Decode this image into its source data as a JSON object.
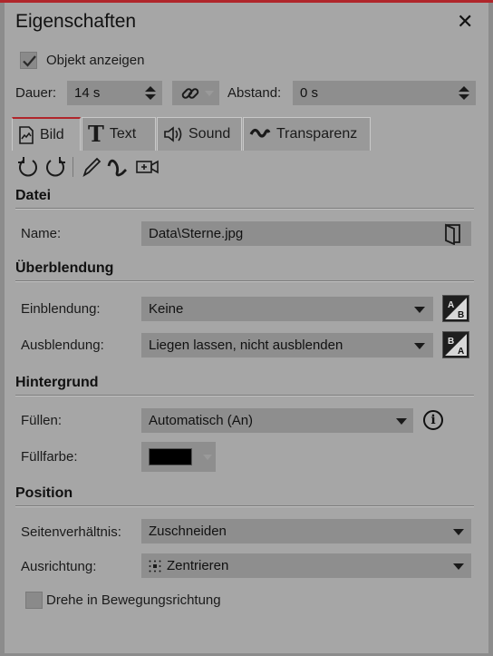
{
  "panel": {
    "title": "Eigenschaften",
    "close_glyph": "✕"
  },
  "show_object": {
    "label": "Objekt anzeigen",
    "checked": true
  },
  "duration": {
    "label": "Dauer:",
    "value": "14 s"
  },
  "spacing": {
    "label": "Abstand:",
    "value": "0 s"
  },
  "tabs": [
    {
      "label": "Bild",
      "icon": "image-icon",
      "active": true
    },
    {
      "label": "Text",
      "icon": "text-T-icon",
      "active": false
    },
    {
      "label": "Sound",
      "icon": "speaker-icon",
      "active": false
    },
    {
      "label": "Transparenz",
      "icon": "transparency-wave-icon",
      "active": false
    }
  ],
  "toolbar_icons": [
    "rotate-left-icon",
    "rotate-right-icon",
    "pencil-icon",
    "curve-path-icon",
    "add-camera-icon"
  ],
  "sections": {
    "datei": "Datei",
    "ueberblendung": "Überblendung",
    "hintergrund": "Hintergrund",
    "position": "Position"
  },
  "file": {
    "label": "Name:",
    "value": "Data\\Sterne.jpg"
  },
  "fade_in": {
    "label": "Einblendung:",
    "value": "Keine"
  },
  "fade_out": {
    "label": "Ausblendung:",
    "value": "Liegen lassen, nicht ausblenden"
  },
  "fill": {
    "label": "Füllen:",
    "value": "Automatisch (An)"
  },
  "fill_color": {
    "label": "Füllfarbe:",
    "color": "#000000"
  },
  "aspect": {
    "label": "Seitenverhältnis:",
    "value": "Zuschneiden"
  },
  "alignment": {
    "label": "Ausrichtung:",
    "value": "Zentrieren"
  },
  "rotate_motion": {
    "label": "Drehe in Bewegungsrichtung",
    "checked": false
  },
  "colors": {
    "accent": "#b0262b",
    "panel": "#a6a6a6",
    "field": "#8e8e8e"
  }
}
